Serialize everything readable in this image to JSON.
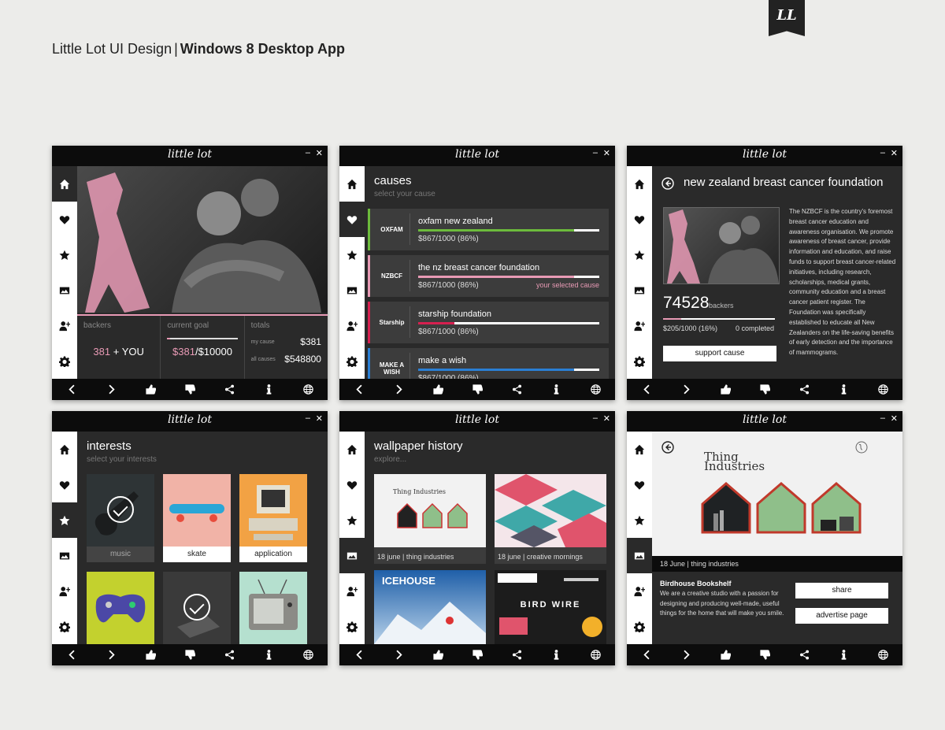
{
  "header": {
    "title_regular": "Little Lot UI Design",
    "separator": "|",
    "title_bold": "Windows 8 Desktop App"
  },
  "brand": {
    "badge": "LL"
  },
  "app": {
    "logo": "little lot",
    "minimize": "–",
    "close": "✕"
  },
  "colors": {
    "accent_pink": "#e89ab5",
    "green": "#6cbb3c",
    "crimson": "#d62050",
    "blue": "#2a7fd4"
  },
  "icons": {
    "sidebar": [
      "home-icon",
      "heart-icon",
      "star-icon",
      "image-icon",
      "add-user-icon",
      "gear-icon"
    ],
    "bottombar": [
      "chevron-left-icon",
      "chevron-right-icon",
      "thumbs-up-icon",
      "thumbs-down-icon",
      "share-icon",
      "info-icon",
      "globe-icon"
    ]
  },
  "screen1": {
    "backers_label": "backers",
    "backers_count": "381",
    "backers_you": "+ YOU",
    "goal_label": "current goal",
    "goal_current": "$381",
    "goal_total": "/$10000",
    "goal_progress": 0.038,
    "totals_label": "totals",
    "my_cause_label": "my cause",
    "my_cause_value": "$381",
    "all_causes_label": "all causes",
    "all_causes_value": "$548800"
  },
  "screen2": {
    "title": "causes",
    "subtitle": "select your cause",
    "causes": [
      {
        "logo": "OXFAM",
        "name": "oxfam new zealand",
        "amount": "$867/1000 (86%)",
        "progress": 0.86,
        "color": "#6cbb3c",
        "note": ""
      },
      {
        "logo": "NZBCF",
        "name": "the nz breast cancer foundation",
        "amount": "$867/1000 (86%)",
        "progress": 0.86,
        "color": "#e89ab5",
        "note": "your selected cause"
      },
      {
        "logo": "Starship",
        "name": "starship foundation",
        "amount": "$867/1000 (86%)",
        "progress": 0.2,
        "color": "#d62050",
        "note": ""
      },
      {
        "logo": "MAKE A WISH",
        "name": "make a wish",
        "amount": "$867/1000 (86%)",
        "progress": 0.86,
        "color": "#2a7fd4",
        "note": ""
      }
    ]
  },
  "screen3": {
    "title": "new zealand breast cancer foundation",
    "backers_count": "74528",
    "backers_label": "backers",
    "amount": "$205/1000 (16%)",
    "progress": 0.16,
    "completed": "0 completed",
    "button": "support cause",
    "description": "The NZBCF is the country's foremost breast cancer education and awareness organisation. We promote awareness of breast cancer, provide information and education, and raise funds to support breast cancer-related initiatives, including research, scholarships, medical grants, community education and a breast cancer patient register. The Foundation was specifically established to educate all New Zealanders on the life-saving benefits of early detection and the importance of mammograms."
  },
  "screen4": {
    "title": "interests",
    "subtitle": "select your interests",
    "tiles": [
      {
        "label": "music",
        "bg": "#2e3436",
        "selected": true
      },
      {
        "label": "skate",
        "bg": "#f1b3a7",
        "selected": false
      },
      {
        "label": "application",
        "bg": "#f2a244",
        "selected": false
      },
      {
        "label": "",
        "bg": "#c3d12e",
        "selected": false
      },
      {
        "label": "",
        "bg": "#3a3a3a",
        "selected": true
      },
      {
        "label": "",
        "bg": "#b5e0cf",
        "selected": false
      }
    ]
  },
  "screen5": {
    "title": "wallpaper history",
    "subtitle": "explore...",
    "items": [
      {
        "caption": "18 june | thing industries",
        "thumb_text": "Thing Industries"
      },
      {
        "caption": "18 june | creative mornings",
        "thumb_text": ""
      },
      {
        "caption": "",
        "thumb_text": "ICEHOUSE"
      },
      {
        "caption": "",
        "thumb_text": "BIRD WIRE"
      }
    ]
  },
  "screen6": {
    "brand_text_1": "Thing",
    "brand_text_2": "Industries",
    "caption": "18 June | thing industries",
    "product_name": "Birdhouse Bookshelf",
    "description": "We are a creative studio with a passion for designing and producing well-made, useful things for the home that will make you smile.",
    "share_button": "share",
    "advertise_button": "advertise page"
  }
}
